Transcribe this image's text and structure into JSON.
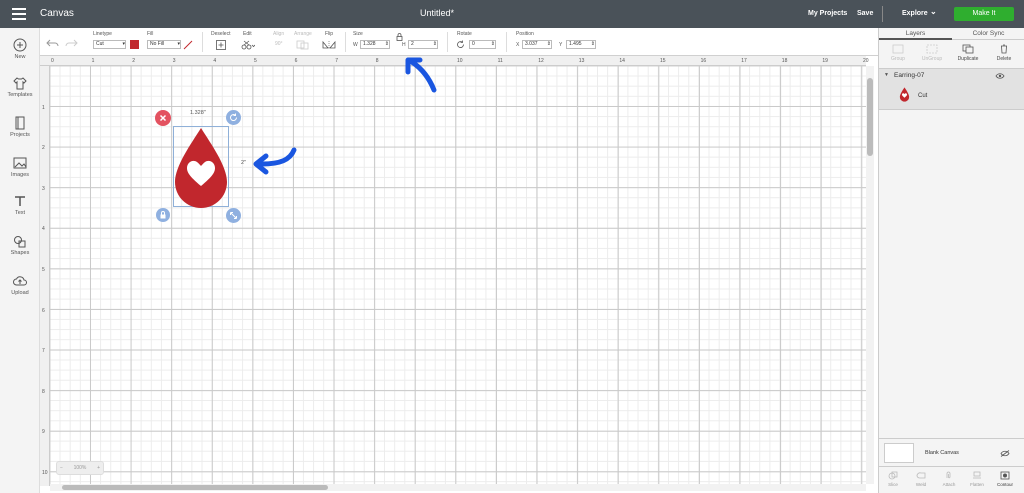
{
  "header": {
    "app_title": "Canvas",
    "doc_title": "Untitled*",
    "my_projects": "My Projects",
    "save": "Save",
    "explore": "Explore",
    "make_it": "Make It",
    "make_it_color": "#2fae2f"
  },
  "left_nav": [
    {
      "label": "New",
      "icon": "plus-circle-icon"
    },
    {
      "label": "Templates",
      "icon": "shirt-icon"
    },
    {
      "label": "Projects",
      "icon": "projects-icon"
    },
    {
      "label": "Images",
      "icon": "image-icon"
    },
    {
      "label": "Text",
      "icon": "text-t-icon"
    },
    {
      "label": "Shapes",
      "icon": "shapes-icon"
    },
    {
      "label": "Upload",
      "icon": "cloud-upload-icon"
    }
  ],
  "toolbar": {
    "linetype_label": "Linetype",
    "linetype_value": "Cut",
    "fill_label": "Fill",
    "fill_value": "No Fill",
    "fill_color": "#c1272d",
    "deselect_label": "Deselect",
    "edit_label": "Edit",
    "align_label": "Align",
    "align_value": "90°",
    "arrange_label": "Arrange",
    "flip_label": "Flip",
    "size_label": "Size",
    "w_label": "W",
    "w_value": "1.328",
    "h_label": "H",
    "h_value": "2",
    "rotate_label": "Rotate",
    "rotate_value": "0",
    "position_label": "Position",
    "x_label": "X",
    "x_value": "3.037",
    "y_label": "Y",
    "y_value": "1.495"
  },
  "rulers": {
    "top": [
      "0",
      "1",
      "2",
      "3",
      "4",
      "5",
      "6",
      "7",
      "8",
      "9",
      "10",
      "11",
      "12",
      "13",
      "14",
      "15",
      "16",
      "17",
      "18",
      "19",
      "20"
    ],
    "left": [
      "1",
      "2",
      "3",
      "4",
      "5",
      "6",
      "7",
      "8",
      "9",
      "10"
    ]
  },
  "canvas": {
    "width_label": "1.328\"",
    "height_label": "2\"",
    "zoom_label": "100%",
    "shape_color": "#c1272d"
  },
  "right_panel": {
    "tab_layers": "Layers",
    "tab_color_sync": "Color Sync",
    "actions": {
      "group": "Group",
      "ungroup": "UnGroup",
      "duplicate": "Duplicate",
      "delete": "Delete"
    },
    "layer_group_name": "Earring-07",
    "layer_item_name": "Cut",
    "blank_canvas": "Blank Canvas",
    "bottom_actions": {
      "slice": "Slice",
      "weld": "Weld",
      "attach": "Attach",
      "flatten": "Flatten",
      "contour": "Contour"
    }
  },
  "annotation_color": "#1a56e0"
}
